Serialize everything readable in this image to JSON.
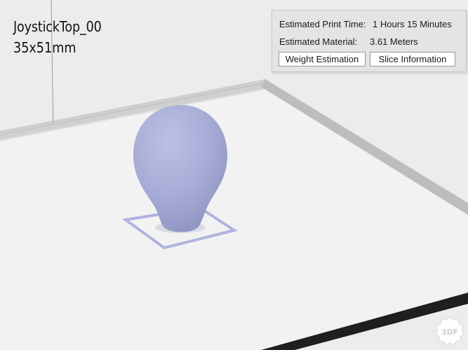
{
  "model": {
    "name": "JoystickTop_00",
    "dimensions": "35x51mm"
  },
  "info_panel": {
    "print_time_label": "Estimated Print Time:",
    "print_time_value": "1 Hours 15 Minutes",
    "material_label": "Estimated Material:",
    "material_value": "3.61 Meters",
    "weight_button": "Weight Estimation",
    "slice_button": "Slice Information"
  },
  "logo": {
    "text": "3DF"
  },
  "colors": {
    "background": "#ececec",
    "build_plate": "#f2f2f2",
    "plate_border": "#bdbdbd",
    "model": "#a9aed6",
    "model_outline": "#aeb4e0",
    "dark_edge": "#1f1f1f"
  }
}
